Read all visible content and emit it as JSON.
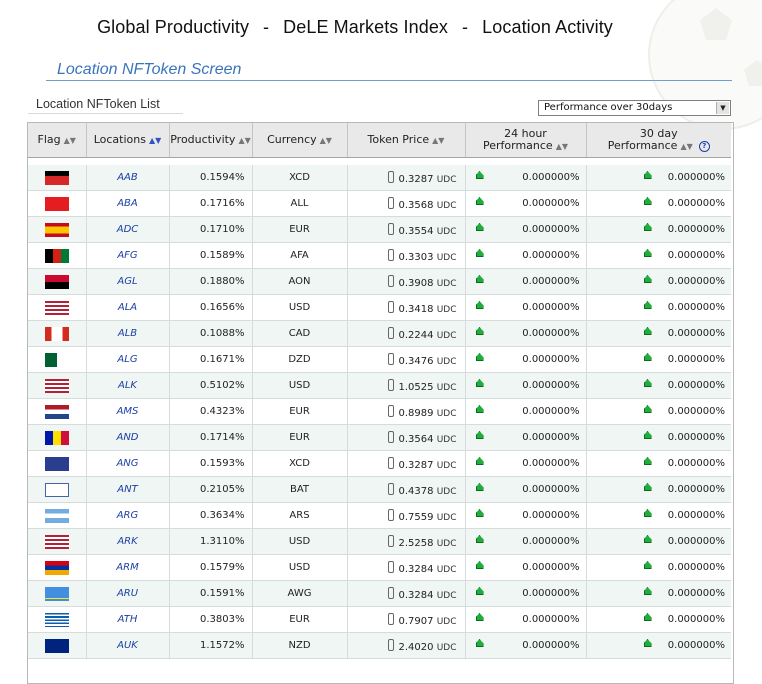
{
  "header": {
    "title_parts": [
      "Global Productivity",
      "DeLE Markets Index",
      "Location Activity"
    ],
    "separator": "-"
  },
  "screen": {
    "title": "Location NFToken Screen"
  },
  "list": {
    "title": "Location NFToken List"
  },
  "performance_select": {
    "selected": "Performance over 30days"
  },
  "table": {
    "columns": {
      "flag": "Flag",
      "locations": "Locations",
      "productivity": "Productivity",
      "currency": "Currency",
      "token_price": "Token Price",
      "perf24_line1": "24 hour",
      "perf24_line2": "Performance",
      "perf30_line1": "30 day",
      "perf30_line2": "Performance"
    },
    "unit": "UDC",
    "rows": [
      {
        "code": "AAB",
        "productivity": "0.1594%",
        "currency": "XCD",
        "price": "0.3287",
        "perf24": "0.000000%",
        "perf30": "0.000000%"
      },
      {
        "code": "ABA",
        "productivity": "0.1716%",
        "currency": "ALL",
        "price": "0.3568",
        "perf24": "0.000000%",
        "perf30": "0.000000%"
      },
      {
        "code": "ADC",
        "productivity": "0.1710%",
        "currency": "EUR",
        "price": "0.3554",
        "perf24": "0.000000%",
        "perf30": "0.000000%"
      },
      {
        "code": "AFG",
        "productivity": "0.1589%",
        "currency": "AFA",
        "price": "0.3303",
        "perf24": "0.000000%",
        "perf30": "0.000000%"
      },
      {
        "code": "AGL",
        "productivity": "0.1880%",
        "currency": "AON",
        "price": "0.3908",
        "perf24": "0.000000%",
        "perf30": "0.000000%"
      },
      {
        "code": "ALA",
        "productivity": "0.1656%",
        "currency": "USD",
        "price": "0.3418",
        "perf24": "0.000000%",
        "perf30": "0.000000%"
      },
      {
        "code": "ALB",
        "productivity": "0.1088%",
        "currency": "CAD",
        "price": "0.2244",
        "perf24": "0.000000%",
        "perf30": "0.000000%"
      },
      {
        "code": "ALG",
        "productivity": "0.1671%",
        "currency": "DZD",
        "price": "0.3476",
        "perf24": "0.000000%",
        "perf30": "0.000000%"
      },
      {
        "code": "ALK",
        "productivity": "0.5102%",
        "currency": "USD",
        "price": "1.0525",
        "perf24": "0.000000%",
        "perf30": "0.000000%"
      },
      {
        "code": "AMS",
        "productivity": "0.4323%",
        "currency": "EUR",
        "price": "0.8989",
        "perf24": "0.000000%",
        "perf30": "0.000000%"
      },
      {
        "code": "AND",
        "productivity": "0.1714%",
        "currency": "EUR",
        "price": "0.3564",
        "perf24": "0.000000%",
        "perf30": "0.000000%"
      },
      {
        "code": "ANG",
        "productivity": "0.1593%",
        "currency": "XCD",
        "price": "0.3287",
        "perf24": "0.000000%",
        "perf30": "0.000000%"
      },
      {
        "code": "ANT",
        "productivity": "0.2105%",
        "currency": "BAT",
        "price": "0.4378",
        "perf24": "0.000000%",
        "perf30": "0.000000%"
      },
      {
        "code": "ARG",
        "productivity": "0.3634%",
        "currency": "ARS",
        "price": "0.7559",
        "perf24": "0.000000%",
        "perf30": "0.000000%"
      },
      {
        "code": "ARK",
        "productivity": "1.3110%",
        "currency": "USD",
        "price": "2.5258",
        "perf24": "0.000000%",
        "perf30": "0.000000%"
      },
      {
        "code": "ARM",
        "productivity": "0.1579%",
        "currency": "USD",
        "price": "0.3284",
        "perf24": "0.000000%",
        "perf30": "0.000000%"
      },
      {
        "code": "ARU",
        "productivity": "0.1591%",
        "currency": "AWG",
        "price": "0.3284",
        "perf24": "0.000000%",
        "perf30": "0.000000%"
      },
      {
        "code": "ATH",
        "productivity": "0.3803%",
        "currency": "EUR",
        "price": "0.7907",
        "perf24": "0.000000%",
        "perf30": "0.000000%"
      },
      {
        "code": "AUK",
        "productivity": "1.1572%",
        "currency": "NZD",
        "price": "2.4020",
        "perf24": "0.000000%",
        "perf30": "0.000000%"
      }
    ]
  },
  "colors": {
    "screen_title": "#3a74bd",
    "location_link": "#1c3fa3",
    "row_alt": "#eff6f4",
    "header_bg": "#e9e9e9",
    "up_arrow": "#1fae3a"
  }
}
